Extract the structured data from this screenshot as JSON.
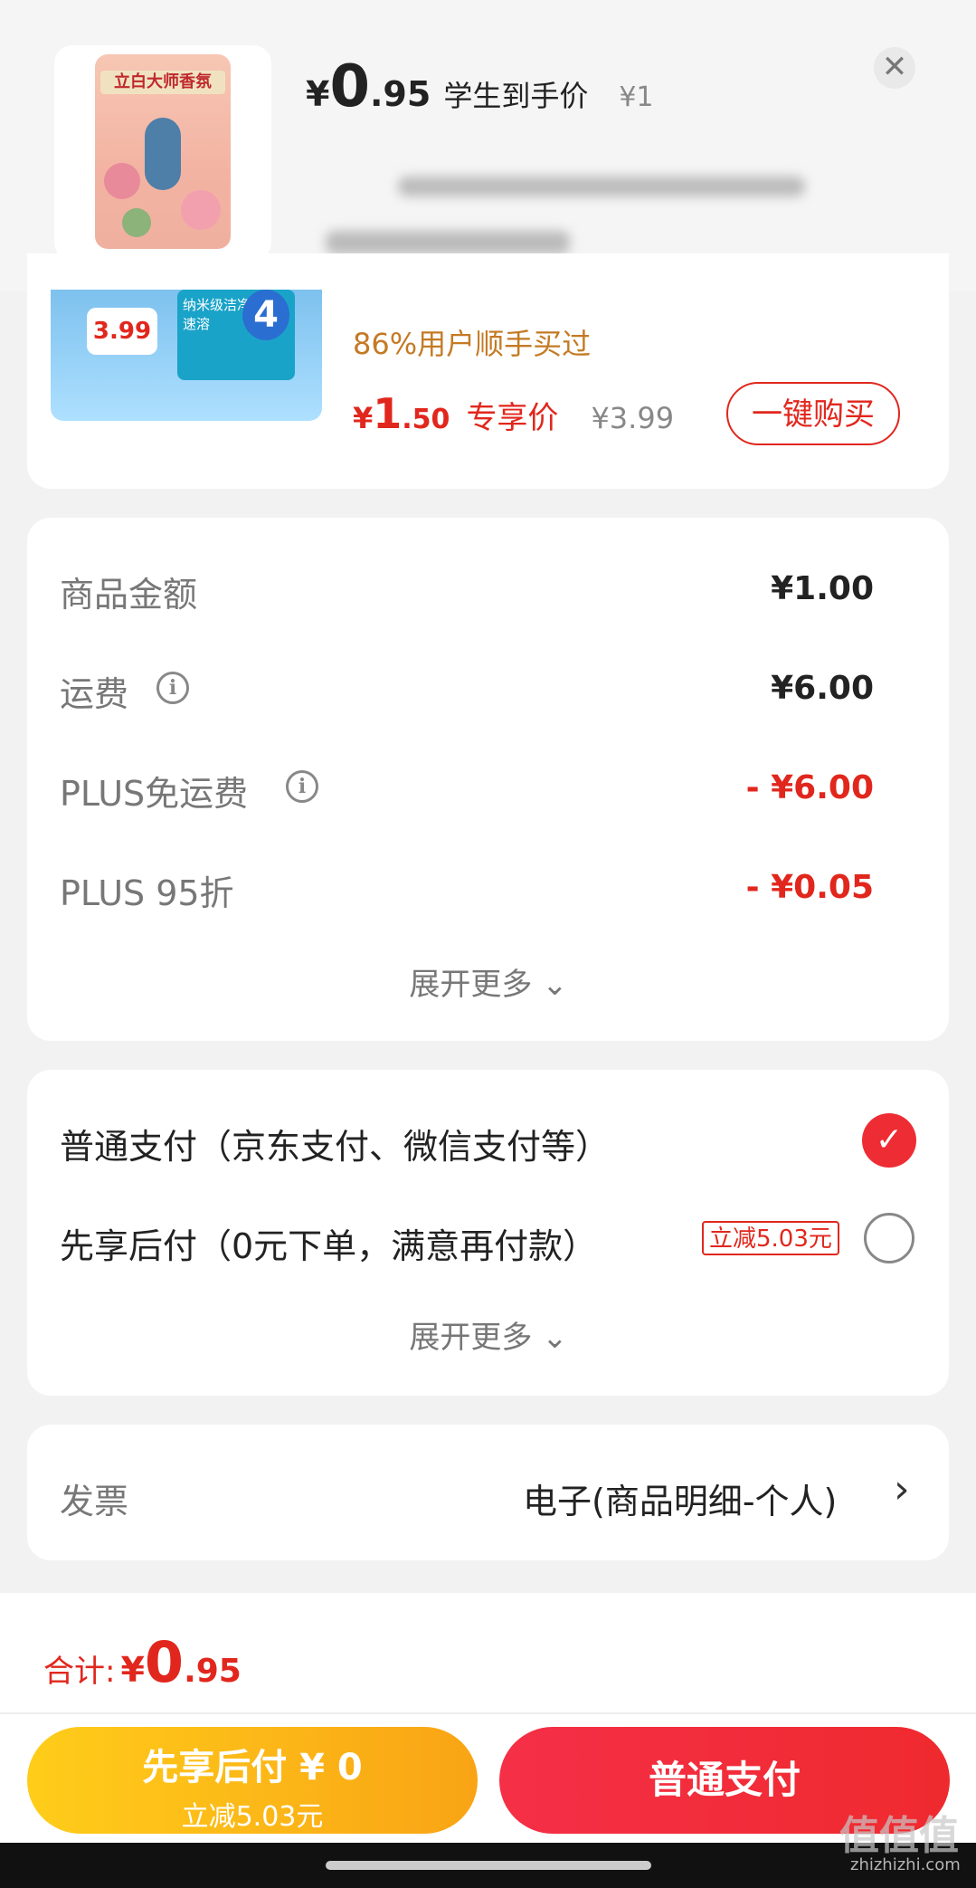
{
  "header": {
    "price_currency": "¥",
    "price_int": "0",
    "price_dec": ".95",
    "price_label": "学生到手价",
    "original_price": "¥1",
    "close_glyph": "✕"
  },
  "recommend": {
    "promo_tag": "3.99",
    "badge_number": "4",
    "box_text": "纳米级洁净 低温速溶",
    "users_text": "86%用户顺手买过",
    "price_currency": "¥",
    "price_int": "1",
    "price_dec": ".50",
    "price_label": "专享价",
    "old_price": "¥3.99",
    "buy_label": "一键购买"
  },
  "summary": {
    "rows": [
      {
        "label": "商品金额",
        "value": "¥1.00"
      },
      {
        "label": "运费",
        "value": "¥6.00"
      },
      {
        "label": "PLUS免运费",
        "value": "- ¥6.00"
      },
      {
        "label": "PLUS 95折",
        "value": "- ¥0.05"
      }
    ],
    "expand_label": "展开更多 ⌄"
  },
  "payment": {
    "option1": "普通支付（京东支付、微信支付等）",
    "option2": "先享后付（0元下单，满意再付款）",
    "option2_tag": "立减5.03元",
    "expand_label": "展开更多 ⌄"
  },
  "invoice": {
    "label": "发票",
    "value": "电子(商品明细-个人)",
    "chevron": "›"
  },
  "footer": {
    "total_label": "合计:",
    "total_currency": "¥",
    "total_int": "0",
    "total_dec": ".95",
    "left_btn_title": "先享后付 ¥ 0",
    "left_btn_sub": "立减5.03元",
    "right_btn": "普通支付"
  },
  "watermark": {
    "text": "值值值",
    "url": "zhizhizhi.com"
  },
  "product_pouch_text": "立白大师香氛",
  "colors": {
    "accent_red": "#e1271d",
    "orange": "#c47a24",
    "yellow": "#f9a415"
  }
}
